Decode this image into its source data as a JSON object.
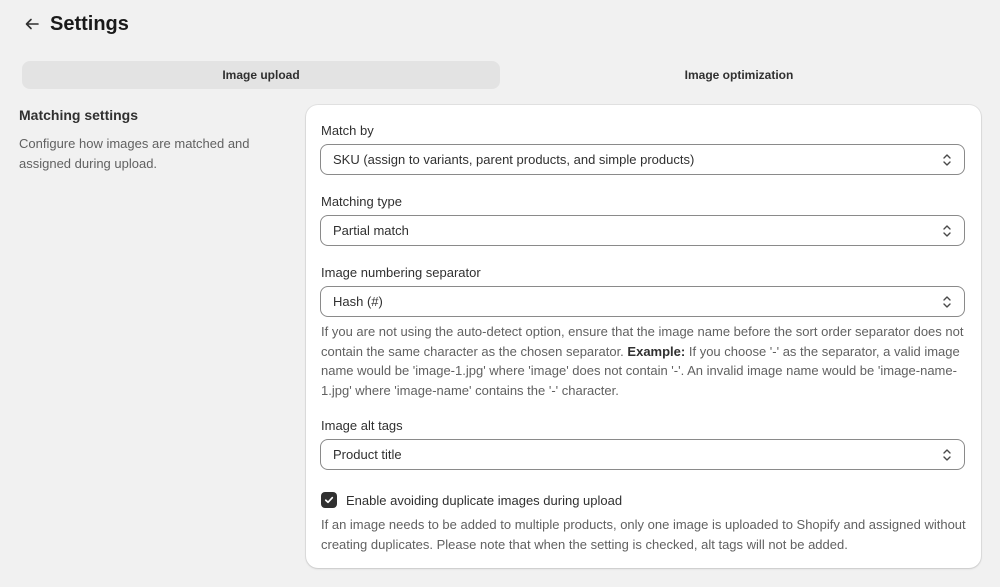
{
  "header": {
    "title": "Settings"
  },
  "tabs": [
    {
      "label": "Image upload",
      "active": true
    },
    {
      "label": "Image optimization",
      "active": false
    }
  ],
  "section": {
    "title": "Matching settings",
    "description": "Configure how images are matched and assigned during upload."
  },
  "fields": {
    "match_by": {
      "label": "Match by",
      "value": "SKU (assign to variants, parent products, and simple products)"
    },
    "matching_type": {
      "label": "Matching type",
      "value": "Partial match"
    },
    "separator": {
      "label": "Image numbering separator",
      "value": "Hash (#)",
      "help_intro": "If you are not using the auto-detect option, ensure that the image name before the sort order separator does not contain the same character as the chosen separator.",
      "help_example_label": "Example:",
      "help_example": "If you choose '-' as the separator, a valid image name would be 'image-1.jpg' where 'image' does not contain '-'. An invalid image name would be 'image-name-1.jpg' where 'image-name' contains the '-' character."
    },
    "alt_tags": {
      "label": "Image alt tags",
      "value": "Product title"
    },
    "avoid_duplicates": {
      "label": "Enable avoiding duplicate images during upload",
      "checked": true,
      "help": "If an image needs to be added to multiple products, only one image is uploaded to Shopify and assigned without creating duplicates. Please note that when the setting is checked, alt tags will not be added."
    }
  },
  "icons": {
    "back": "arrow-left-icon",
    "select_chevron": "chevron-up-down-icon",
    "check": "checkmark-icon"
  },
  "colors": {
    "background": "#f1f1f1",
    "card": "#ffffff",
    "active_tab": "#e3e3e3",
    "checkbox": "#303030"
  }
}
